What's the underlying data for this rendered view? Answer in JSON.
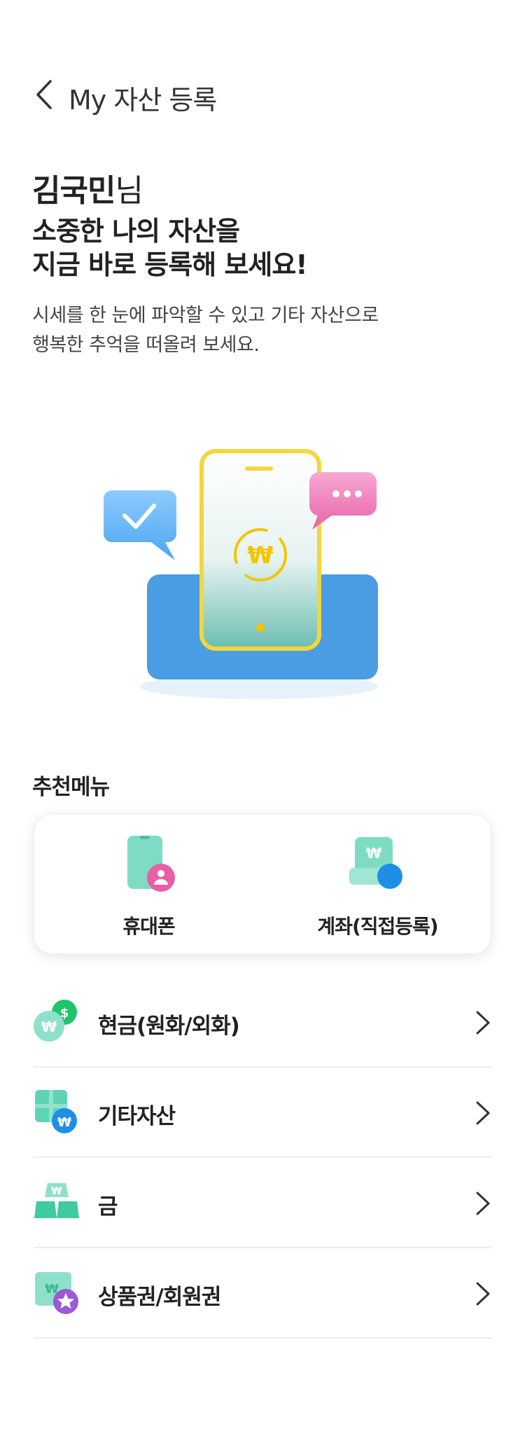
{
  "header": {
    "title": "My 자산 등록"
  },
  "greeting": {
    "name": "김국민",
    "suffix": "님"
  },
  "headline": {
    "line1": "소중한 나의 자산을",
    "line2": "지금 바로 등록해 보세요!"
  },
  "description": {
    "line1": "시세를 한 눈에 파악할 수 있고 기타 자산으로",
    "line2": "행복한 추억을 떠올려 보세요."
  },
  "recommend": {
    "title": "추천메뉴",
    "items": [
      {
        "label": "휴대폰",
        "icon": "phone-person-icon"
      },
      {
        "label": "계좌(직접등록)",
        "icon": "account-won-icon"
      }
    ]
  },
  "list": [
    {
      "label": "현금(원화/외화)",
      "icon": "cash-coins-icon"
    },
    {
      "label": "기타자산",
      "icon": "other-assets-icon"
    },
    {
      "label": "금",
      "icon": "gold-bars-icon"
    },
    {
      "label": "상품권/회원권",
      "icon": "voucher-icon"
    }
  ],
  "colors": {
    "mint": "#5fd3b5",
    "blue": "#1e8fe6",
    "pink": "#e85fa6",
    "yellow": "#f4d63a",
    "purple": "#9b59d8"
  }
}
